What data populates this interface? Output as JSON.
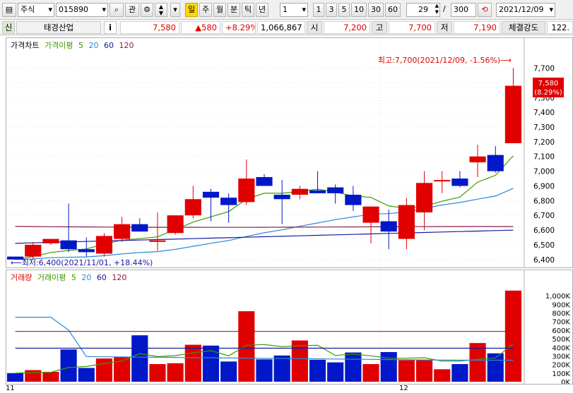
{
  "toolbar": {
    "market_select": "주식",
    "code_input": "015890",
    "search_label": "관",
    "periods": [
      "일",
      "주",
      "월",
      "분",
      "틱",
      "년"
    ],
    "active_period": "일",
    "interval_value": "1",
    "quick_intervals": [
      "1",
      "3",
      "5",
      "10",
      "30",
      "60"
    ],
    "count_value": "29",
    "count_separator": "/",
    "count_total": "300",
    "date_value": "2021/12/09"
  },
  "quote": {
    "sector_label": "신",
    "name": "태경산업",
    "info_label": "i",
    "price": "7,580",
    "change": "▲580",
    "change_pct": "+8.29%",
    "volume": "1,066,867",
    "open_label": "시",
    "open": "7,200",
    "high_label": "고",
    "high": "7,700",
    "low_label": "저",
    "low": "7,190",
    "strength_label": "체결강도",
    "strength": "122."
  },
  "price_chart": {
    "legend": {
      "title": "가격차트",
      "ma_title": "가격이평",
      "ma": [
        "5",
        "20",
        "60",
        "120"
      ]
    },
    "max_label": "최고:7,700(2021/12/09, -1.56%)⟶",
    "min_label": "⟵최저:6,400(2021/11/01, +18.44%)",
    "current_badge_price": "7,580",
    "current_badge_pct": "(8.29%)",
    "yticks": [
      "7,700",
      "7,600",
      "7,500",
      "7,400",
      "7,300",
      "7,200",
      "7,100",
      "7,000",
      "6,900",
      "6,800",
      "6,700",
      "6,600",
      "6,500",
      "6,400"
    ]
  },
  "volume_chart": {
    "legend": {
      "title": "거래량",
      "ma_title": "거래이평",
      "ma": [
        "5",
        "20",
        "60",
        "120"
      ]
    },
    "yticks": [
      "1,000K",
      "900K",
      "800K",
      "700K",
      "600K",
      "500K",
      "400K",
      "300K",
      "200K",
      "100K",
      "0K"
    ]
  },
  "x_axis": {
    "labels": [
      "11",
      "12"
    ]
  },
  "colors": {
    "up": "#e00000",
    "down": "#0018c8",
    "ma5": "#3a9a00",
    "ma20": "#2a8ad4",
    "ma60": "#1a1aa0",
    "ma120": "#8a1a4a"
  },
  "chart_data": {
    "type": "candlestick",
    "dates": [
      "11/01",
      "11/02",
      "11/03",
      "11/04",
      "11/05",
      "11/08",
      "11/09",
      "11/10",
      "11/11",
      "11/12",
      "11/15",
      "11/16",
      "11/17",
      "11/18",
      "11/19",
      "11/22",
      "11/23",
      "11/24",
      "11/25",
      "11/26",
      "11/29",
      "11/30",
      "12/01",
      "12/02",
      "12/03",
      "12/06",
      "12/07",
      "12/08",
      "12/09"
    ],
    "open": [
      6420,
      6420,
      6510,
      6530,
      6470,
      6440,
      6540,
      6640,
      6520,
      6580,
      6700,
      6860,
      6820,
      6790,
      6960,
      6840,
      6840,
      6870,
      6890,
      6840,
      6650,
      6660,
      6540,
      6720,
      6940,
      6950,
      7060,
      7110,
      7190
    ],
    "high": [
      6420,
      6520,
      6540,
      6780,
      6550,
      6580,
      6690,
      6680,
      6720,
      6700,
      6900,
      6880,
      6850,
      7080,
      6980,
      6940,
      6900,
      7000,
      6910,
      6900,
      6700,
      6740,
      6820,
      7000,
      7000,
      7000,
      7180,
      7170,
      7700
    ],
    "low": [
      6400,
      6400,
      6500,
      6450,
      6420,
      6420,
      6520,
      6600,
      6460,
      6570,
      6680,
      6660,
      6650,
      6770,
      6900,
      6640,
      6810,
      6850,
      6780,
      6730,
      6510,
      6470,
      6470,
      6600,
      6850,
      6890,
      6960,
      6990,
      7190
    ],
    "close": [
      6400,
      6500,
      6540,
      6470,
      6450,
      6560,
      6640,
      6590,
      6530,
      6700,
      6810,
      6820,
      6770,
      6950,
      6900,
      6810,
      6880,
      6850,
      6850,
      6770,
      6760,
      6590,
      6770,
      6920,
      6940,
      6900,
      7100,
      7000,
      7580
    ],
    "volume": [
      100,
      135,
      115,
      375,
      160,
      270,
      285,
      540,
      205,
      215,
      430,
      420,
      235,
      820,
      260,
      305,
      480,
      255,
      225,
      340,
      205,
      345,
      250,
      255,
      145,
      205,
      450,
      330,
      1060
    ],
    "volume_unit": "K",
    "ylim": [
      6380,
      7760
    ],
    "volume_ylim": [
      0,
      1100
    ]
  }
}
